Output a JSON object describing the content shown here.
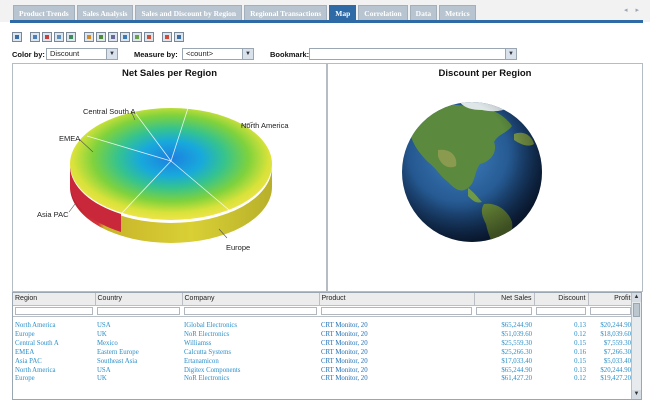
{
  "tabs": [
    {
      "label": "Product Trends",
      "active": false
    },
    {
      "label": "Sales Analysis",
      "active": false
    },
    {
      "label": "Sales and Discount by Region",
      "active": false
    },
    {
      "label": "Regional Transactions",
      "active": false
    },
    {
      "label": "Map",
      "active": true
    },
    {
      "label": "Correlation",
      "active": false
    },
    {
      "label": "Data",
      "active": false
    },
    {
      "label": "Metrics",
      "active": false
    }
  ],
  "tab_scroll_arrows": "◂ ▸",
  "toolbar": {
    "icons": [
      "home-icon",
      "save-icon",
      "print-icon",
      "calendar-icon",
      "export-icon",
      "bar-chart-icon",
      "column-chart-icon",
      "grid-icon",
      "line-chart-icon",
      "area-chart-icon",
      "pie-chart-icon",
      "chart-type-icon",
      "table-icon"
    ]
  },
  "filters": {
    "color_by_label": "Color by:",
    "color_by_value": "Discount",
    "measure_by_label": "Measure by:",
    "measure_by_value": "<count>",
    "bookmark_label": "Bookmark:",
    "bookmark_value": ""
  },
  "net_sales_chart": {
    "title": "Net Sales per Region",
    "labels": [
      "Central South A",
      "North America",
      "EMEA",
      "Asia PAC",
      "Europe"
    ]
  },
  "discount_chart": {
    "title": "Discount per Region"
  },
  "table": {
    "columns": [
      "Region",
      "Country",
      "Company",
      "Product",
      "Net Sales",
      "Discount",
      "Profit"
    ],
    "rows": [
      [
        "North America",
        "USA",
        "IGlobal Electronics",
        "CRT Monitor, 20",
        "$65,244.90",
        "0.13",
        "$20,244.90"
      ],
      [
        "Europe",
        "UK",
        "NoR Electronics",
        "CRT Monitor, 20",
        "$51,039.60",
        "0.12",
        "$18,039.60"
      ],
      [
        "Central South A",
        "Mexico",
        "Williamss",
        "CRT Monitor, 20",
        "$25,559.30",
        "0.15",
        "$7,559.30"
      ],
      [
        "EMEA",
        "Eastern Europe",
        "Calcutta Systems",
        "CRT Monitor, 20",
        "$25,266.30",
        "0.16",
        "$7,266.30"
      ],
      [
        "Asia PAC",
        "Southeast Asia",
        "Ertanamicon",
        "CRT Monitor, 20",
        "$17,033.40",
        "0.15",
        "$5,033.40"
      ],
      [
        "North America",
        "USA",
        "Digitex Components",
        "CRT Monitor, 20",
        "$65,244.90",
        "0.13",
        "$20,244.90"
      ],
      [
        "Europe",
        "UK",
        "NoR Electronics",
        "CRT Monitor, 20",
        "$61,427.20",
        "0.12",
        "$19,427.20"
      ]
    ]
  }
}
